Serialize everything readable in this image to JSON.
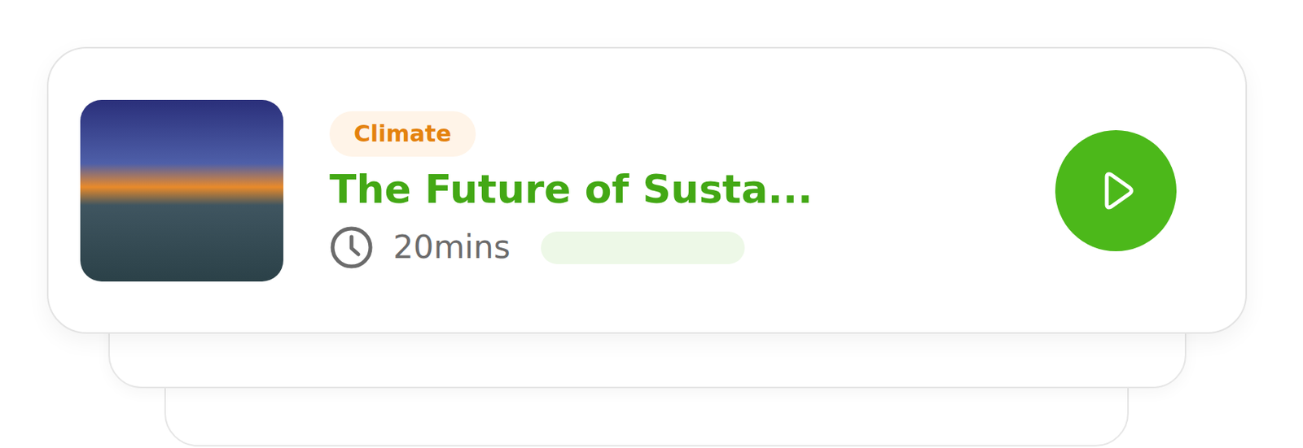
{
  "episode": {
    "category": "Climate",
    "title": "The Future of Susta...",
    "duration": "20mins",
    "progress": {
      "level": 0
    }
  }
}
